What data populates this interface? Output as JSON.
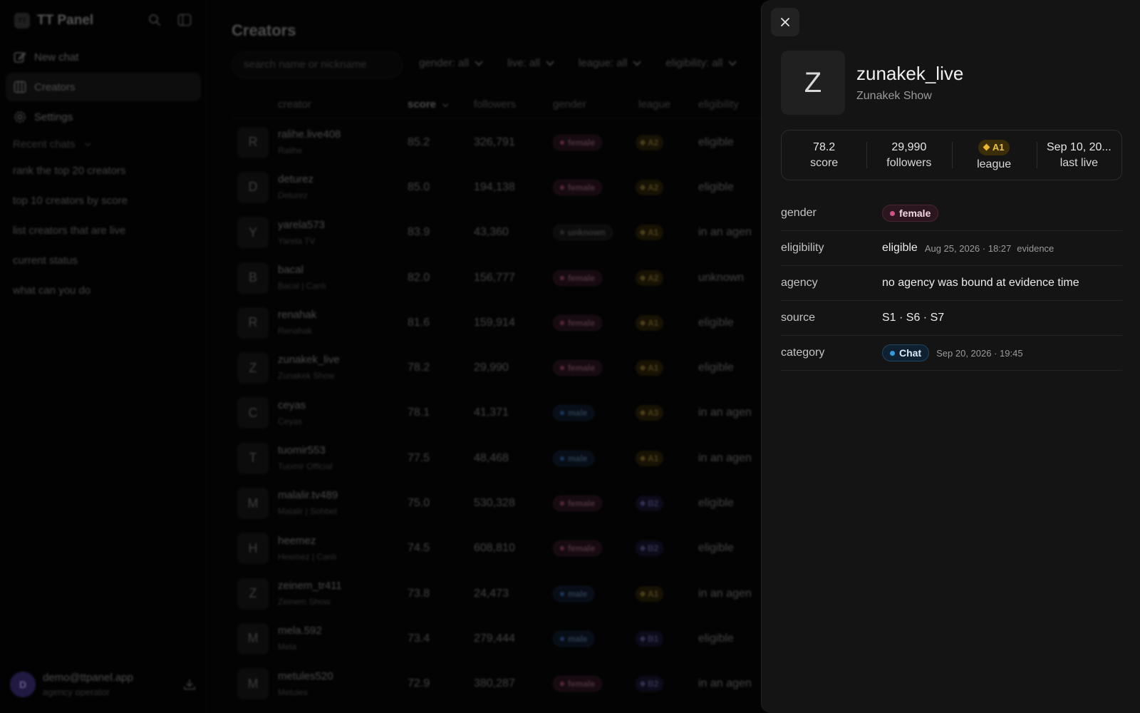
{
  "app": {
    "title": "TT Panel",
    "logo_text": "TT"
  },
  "sidebar": {
    "nav": [
      {
        "label": "New chat",
        "icon": "edit-icon"
      },
      {
        "label": "Creators",
        "icon": "columns-icon",
        "active": true
      },
      {
        "label": "Settings",
        "icon": "gear-icon"
      }
    ],
    "recent_label": "Recent chats",
    "recent": [
      "rank the top 20 creators",
      "top 10 creators by score",
      "list creators that are live",
      "current status",
      "what can you do"
    ],
    "user": {
      "initial": "D",
      "email": "demo@ttpanel.app",
      "role": "agency operator"
    }
  },
  "main": {
    "title": "Creators",
    "search_placeholder": "search name or nickname",
    "filters": [
      "gender: all",
      "live: all",
      "league: all",
      "eligibility: all"
    ],
    "columns": [
      "creator",
      "score",
      "followers",
      "gender",
      "league",
      "eligibility"
    ],
    "rows": [
      {
        "initial": "R",
        "name": "ralihe.live408",
        "nick": "Ralihe",
        "score": "85.2",
        "followers": "326,791",
        "gender": "female",
        "league": "A2",
        "eligibility": "eligible"
      },
      {
        "initial": "D",
        "name": "deturez",
        "nick": "Deturez",
        "score": "85.0",
        "followers": "194,138",
        "gender": "female",
        "league": "A2",
        "eligibility": "eligible"
      },
      {
        "initial": "Y",
        "name": "yarela573",
        "nick": "Yarela TV",
        "score": "83.9",
        "followers": "43,360",
        "gender": "unknown",
        "league": "A1",
        "eligibility": "in an agen"
      },
      {
        "initial": "B",
        "name": "bacal",
        "nick": "Bacal | Canlı",
        "score": "82.0",
        "followers": "156,777",
        "gender": "female",
        "league": "A2",
        "eligibility": "unknown"
      },
      {
        "initial": "R",
        "name": "renahak",
        "nick": "Renahak",
        "score": "81.6",
        "followers": "159,914",
        "gender": "female",
        "league": "A1",
        "eligibility": "eligible"
      },
      {
        "initial": "Z",
        "name": "zunakek_live",
        "nick": "Zunakek Show",
        "score": "78.2",
        "followers": "29,990",
        "gender": "female",
        "league": "A1",
        "eligibility": "eligible"
      },
      {
        "initial": "C",
        "name": "ceyas",
        "nick": "Ceyas",
        "score": "78.1",
        "followers": "41,371",
        "gender": "male",
        "league": "A3",
        "eligibility": "in an agen"
      },
      {
        "initial": "T",
        "name": "tuomir553",
        "nick": "Tuomir Official",
        "score": "77.5",
        "followers": "48,468",
        "gender": "male",
        "league": "A1",
        "eligibility": "in an agen"
      },
      {
        "initial": "M",
        "name": "malalir.tv489",
        "nick": "Malalir | Sohbet",
        "score": "75.0",
        "followers": "530,328",
        "gender": "female",
        "league": "B2",
        "eligibility": "eligible"
      },
      {
        "initial": "H",
        "name": "heemez",
        "nick": "Heemez | Canlı",
        "score": "74.5",
        "followers": "608,810",
        "gender": "female",
        "league": "B2",
        "eligibility": "eligible"
      },
      {
        "initial": "Z",
        "name": "zeinem_tr411",
        "nick": "Zeinem Show",
        "score": "73.8",
        "followers": "24,473",
        "gender": "male",
        "league": "A1",
        "eligibility": "in an agen"
      },
      {
        "initial": "M",
        "name": "mela.592",
        "nick": "Mela",
        "score": "73.4",
        "followers": "279,444",
        "gender": "male",
        "league": "B1",
        "eligibility": "eligible"
      },
      {
        "initial": "M",
        "name": "metules520",
        "nick": "Metules",
        "score": "72.9",
        "followers": "380,287",
        "gender": "female",
        "league": "B2",
        "eligibility": "in an agen"
      }
    ]
  },
  "panel": {
    "initial": "Z",
    "name": "zunakek_live",
    "nick": "Zunakek Show",
    "stats": {
      "score": {
        "value": "78.2",
        "label": "score"
      },
      "followers": {
        "value": "29,990",
        "label": "followers"
      },
      "league": {
        "value": "A1",
        "label": "league"
      },
      "last_live": {
        "value": "Sep 10, 20...",
        "label": "last live"
      }
    },
    "details": {
      "gender": {
        "key": "gender",
        "value": "female"
      },
      "eligibility": {
        "key": "eligibility",
        "value": "eligible",
        "time": "Aug 25, 2026 · 18:27",
        "link": "evidence"
      },
      "agency": {
        "key": "agency",
        "value": "no agency was bound at evidence time"
      },
      "source": {
        "key": "source",
        "value": "S1 · S6 · S7"
      },
      "category": {
        "key": "category",
        "value": "Chat",
        "time": "Sep 20, 2026 · 19:45"
      }
    }
  }
}
